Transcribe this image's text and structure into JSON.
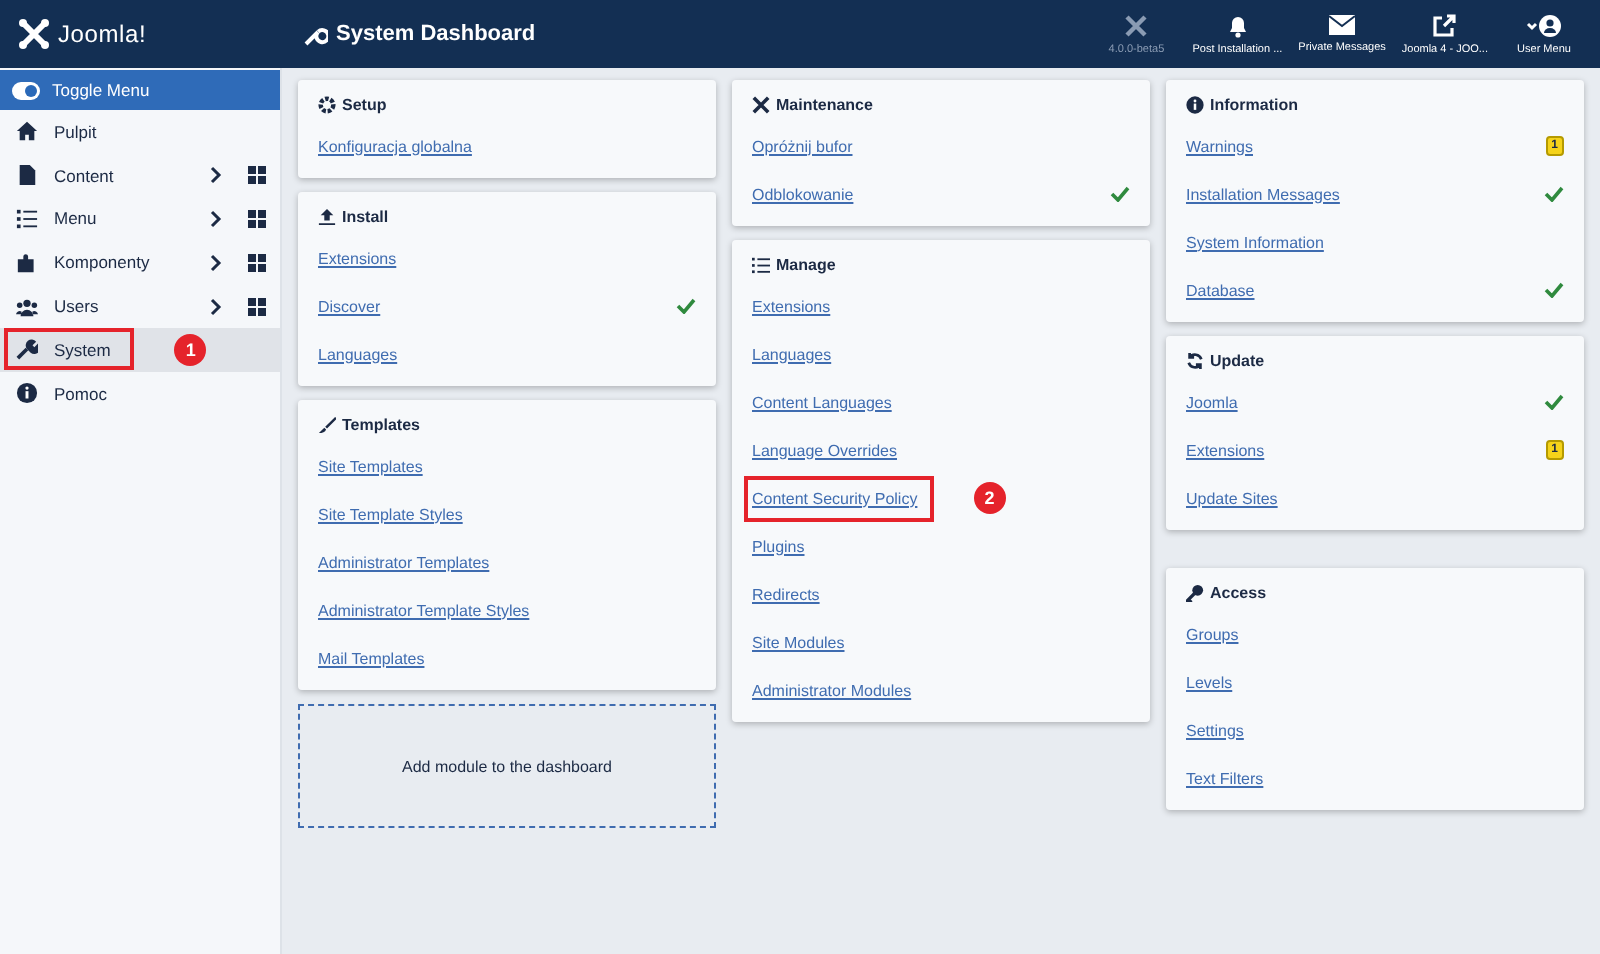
{
  "header": {
    "logo": "Joomla!",
    "title": "System Dashboard",
    "tools": [
      {
        "label": "4.0.0-beta5",
        "kind": "version"
      },
      {
        "label": "Post Installation ...",
        "kind": "bell"
      },
      {
        "label": "Private Messages",
        "kind": "mail"
      },
      {
        "label": "Joomla 4 - JOO...",
        "kind": "external"
      },
      {
        "label": "User Menu",
        "kind": "user"
      }
    ]
  },
  "sidebar": {
    "toggle": "Toggle Menu",
    "items": [
      {
        "label": "Pulpit",
        "expandable": false,
        "selected": false,
        "highlighted": false
      },
      {
        "label": "Content",
        "expandable": true,
        "selected": false,
        "highlighted": false
      },
      {
        "label": "Menu",
        "expandable": true,
        "selected": false,
        "highlighted": false
      },
      {
        "label": "Komponenty",
        "expandable": true,
        "selected": false,
        "highlighted": false
      },
      {
        "label": "Users",
        "expandable": true,
        "selected": false,
        "highlighted": false
      },
      {
        "label": "System",
        "expandable": false,
        "selected": true,
        "highlighted": true,
        "callout": "1"
      },
      {
        "label": "Pomoc",
        "expandable": false,
        "selected": false,
        "highlighted": false
      }
    ]
  },
  "columns": [
    {
      "cards": [
        {
          "title": "Setup",
          "links": [
            {
              "label": "Konfiguracja globalna",
              "checked": false,
              "highlighted": false
            }
          ]
        },
        {
          "title": "Install",
          "links": [
            {
              "label": "Extensions",
              "checked": false,
              "highlighted": false
            },
            {
              "label": "Discover",
              "checked": true,
              "highlighted": false
            },
            {
              "label": "Languages",
              "checked": false,
              "highlighted": false
            }
          ]
        },
        {
          "title": "Templates",
          "links": [
            {
              "label": "Site Templates",
              "checked": false,
              "highlighted": false
            },
            {
              "label": "Site Template Styles",
              "checked": false,
              "highlighted": false
            },
            {
              "label": "Administrator Templates",
              "checked": false,
              "highlighted": false
            },
            {
              "label": "Administrator Template Styles",
              "checked": false,
              "highlighted": false
            },
            {
              "label": "Mail Templates",
              "checked": false,
              "highlighted": false
            }
          ]
        }
      ],
      "add_module": "Add module to the dashboard"
    },
    {
      "cards": [
        {
          "title": "Maintenance",
          "links": [
            {
              "label": "Opróżnij bufor",
              "checked": false,
              "highlighted": false
            },
            {
              "label": "Odblokowanie",
              "checked": true,
              "highlighted": false
            }
          ]
        },
        {
          "title": "Manage",
          "links": [
            {
              "label": "Extensions",
              "checked": false,
              "highlighted": false
            },
            {
              "label": "Languages",
              "checked": false,
              "highlighted": false
            },
            {
              "label": "Content Languages",
              "checked": false,
              "highlighted": false
            },
            {
              "label": "Language Overrides",
              "checked": false,
              "highlighted": false
            },
            {
              "label": "Content Security Policy",
              "checked": false,
              "highlighted": true,
              "callout": "2"
            },
            {
              "label": "Plugins",
              "checked": false,
              "highlighted": false
            },
            {
              "label": "Redirects",
              "checked": false,
              "highlighted": false
            },
            {
              "label": "Site Modules",
              "checked": false,
              "highlighted": false
            },
            {
              "label": "Administrator Modules",
              "checked": false,
              "highlighted": false
            }
          ]
        }
      ]
    },
    {
      "cards": [
        {
          "title": "Information",
          "links": [
            {
              "label": "Warnings",
              "checked": false,
              "badge": "1",
              "highlighted": false
            },
            {
              "label": "Installation Messages",
              "checked": true,
              "highlighted": false
            },
            {
              "label": "System Information",
              "checked": false,
              "highlighted": false
            },
            {
              "label": "Database",
              "checked": true,
              "highlighted": false
            }
          ]
        },
        {
          "title": "Update",
          "links": [
            {
              "label": "Joomla",
              "checked": true,
              "highlighted": false
            },
            {
              "label": "Extensions",
              "checked": false,
              "badge": "1",
              "highlighted": false
            },
            {
              "label": "Update Sites",
              "checked": false,
              "highlighted": false
            }
          ]
        },
        {
          "title": "Access",
          "links": [
            {
              "label": "Groups",
              "checked": false,
              "highlighted": false
            },
            {
              "label": "Levels",
              "checked": false,
              "highlighted": false
            },
            {
              "label": "Settings",
              "checked": false,
              "highlighted": false
            },
            {
              "label": "Text Filters",
              "checked": false,
              "highlighted": false
            }
          ]
        }
      ]
    }
  ]
}
